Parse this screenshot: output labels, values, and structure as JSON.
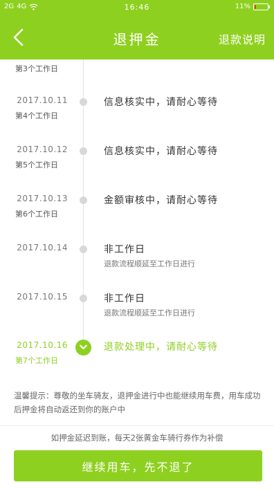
{
  "status_bar": {
    "signal_left": "2G",
    "network": "4G",
    "time": "16:46",
    "battery_text": "11%",
    "battery_percent": 11,
    "battery_color": "#e8302a"
  },
  "header": {
    "title": "退押金",
    "right_link": "退款说明",
    "bg_color": "#8ed020"
  },
  "timeline": {
    "top_workday": "第3个工作日",
    "rows": [
      {
        "date": "2017.10.11",
        "workday": "第4个工作日",
        "title": "信息核实中，请耐心等待",
        "sub": "",
        "active": false
      },
      {
        "date": "2017.10.12",
        "workday": "第5个工作日",
        "title": "信息核实中，请耐心等待",
        "sub": "",
        "active": false
      },
      {
        "date": "2017.10.13",
        "workday": "第6个工作日",
        "title": "金额审核中，请耐心等待",
        "sub": "",
        "active": false
      },
      {
        "date": "2017.10.14",
        "workday": "",
        "title": "非工作日",
        "sub": "退款流程顺延至工作日进行",
        "active": false
      },
      {
        "date": "2017.10.15",
        "workday": "",
        "title": "非工作日",
        "sub": "退款流程顺延至工作日进行",
        "active": false
      },
      {
        "date": "2017.10.16",
        "workday": "第7个工作日",
        "title": "退款处理中，请耐心等待",
        "sub": "",
        "active": true
      }
    ]
  },
  "tip": {
    "text": "温馨提示：尊敬的坐车骑友，退押金进行中也能继续用车费，用车成功后押金将自动返还到你的账户中"
  },
  "bottom_note": "如押金延迟到账，每天2张黄金车骑行券作为补偿",
  "cta_label": "继续用车，先不退了"
}
